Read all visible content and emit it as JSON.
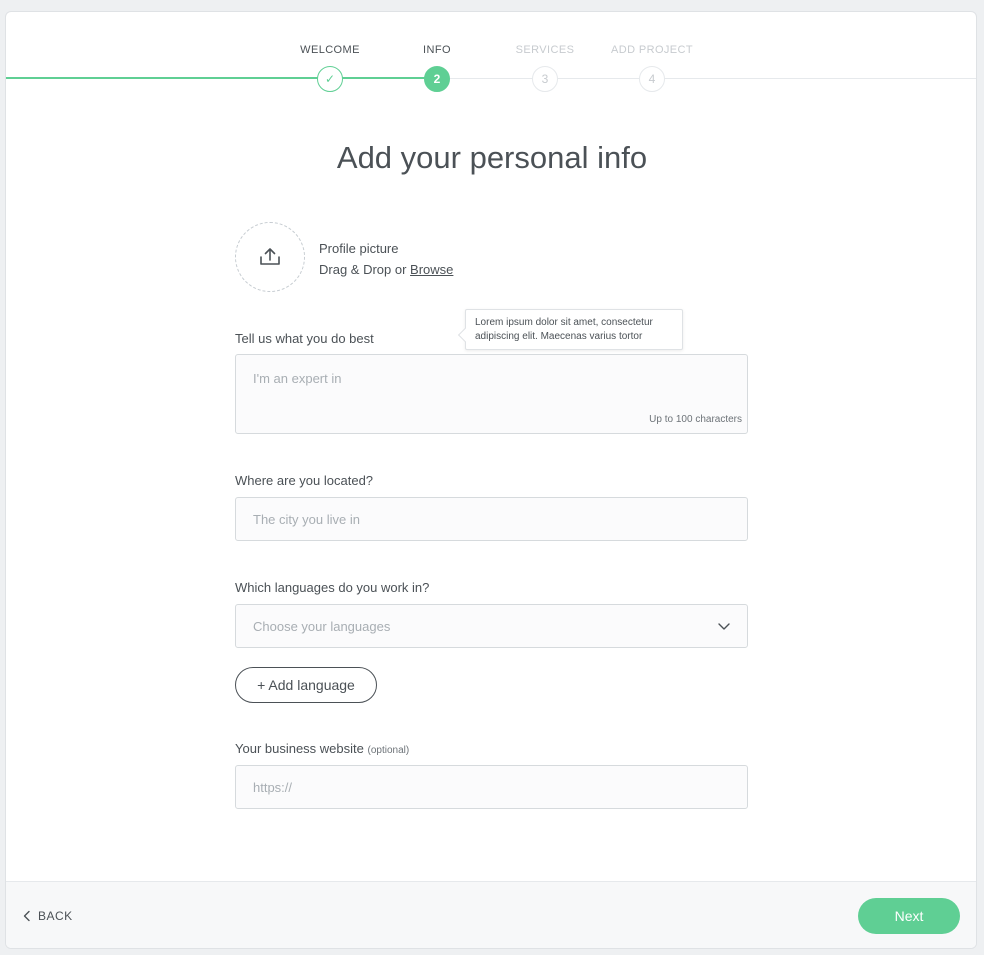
{
  "stepper": {
    "steps": [
      {
        "label": "WELCOME",
        "marker": "✓",
        "state": "done"
      },
      {
        "label": "INFO",
        "marker": "2",
        "state": "active"
      },
      {
        "label": "SERVICES",
        "marker": "3",
        "state": "todo"
      },
      {
        "label": "ADD PROJECT",
        "marker": "4",
        "state": "todo"
      }
    ],
    "accent_color": "#5fcf94"
  },
  "page": {
    "title": "Add your personal info"
  },
  "profile": {
    "label": "Profile picture",
    "drag_text": "Drag & Drop or",
    "browse_link": "Browse",
    "icon": "upload-icon"
  },
  "tooltip": {
    "text": "Lorem ipsum dolor sit amet, consectetur adipiscing elit. Maecenas varius tortor"
  },
  "best": {
    "label": "Tell us what you do best",
    "placeholder": "I'm an expert in",
    "counter": "Up to 100 characters"
  },
  "location": {
    "label": "Where are you located?",
    "placeholder": "The city you live in"
  },
  "languages": {
    "label": "Which languages do you work in?",
    "placeholder": "Choose your languages",
    "add_button": "+ Add language"
  },
  "website": {
    "label": "Your business website",
    "optional": "(optional)",
    "placeholder": "https://"
  },
  "footer": {
    "back_label": "BACK",
    "next_label": "Next"
  }
}
